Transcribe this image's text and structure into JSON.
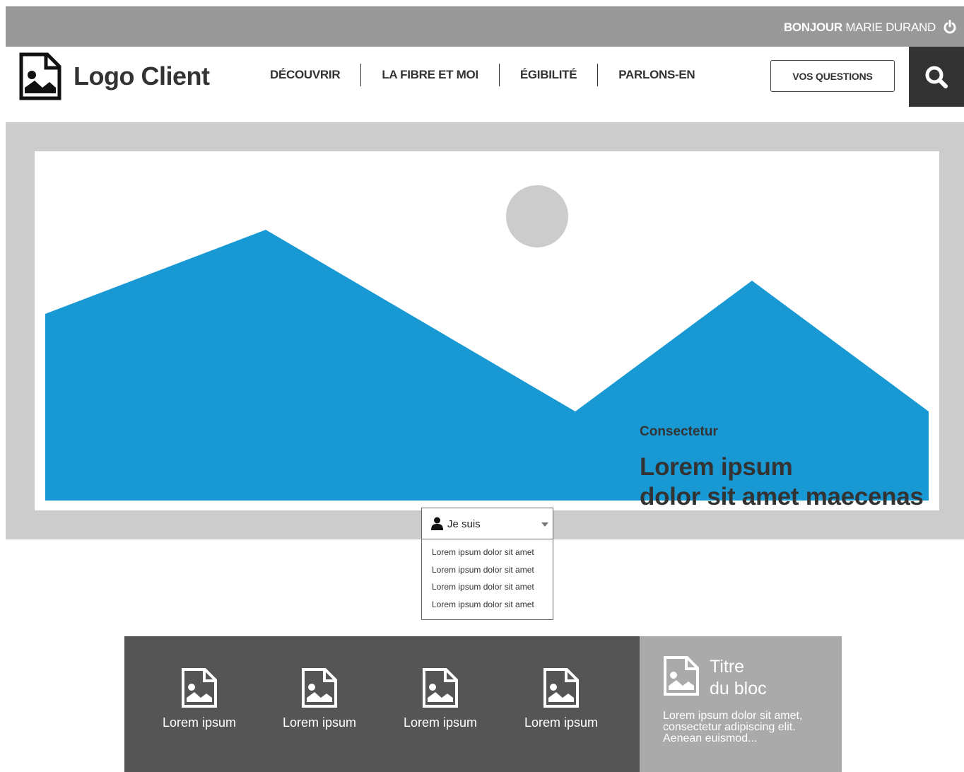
{
  "topbar": {
    "greeting_bold": "BONJOUR",
    "greeting_name": "MARIE DURAND",
    "power_icon": "power-icon"
  },
  "header": {
    "logo_text": "Logo Client",
    "logo_icon": "image-file-icon",
    "nav": [
      "DÉCOUVRIR",
      "LA FIBRE ET MOI",
      "ÉGIBILITÉ",
      "PARLONS-EN"
    ],
    "cta_label": "VOS QUESTIONS",
    "search_icon": "search-icon"
  },
  "hero": {
    "kicker": "Consectetur",
    "title_line1": "Lorem ipsum",
    "title_line2": "dolor sit amet maecenas",
    "mountain_color": "#1899d4",
    "sun_color": "#cccccc"
  },
  "dropdown": {
    "label": "Je suis",
    "options": [
      "Lorem ipsum dolor sit amet",
      "Lorem ipsum dolor sit amet",
      "Lorem ipsum dolor sit amet",
      "Lorem ipsum dolor sit amet"
    ]
  },
  "tiles": [
    {
      "label": "Lorem ipsum",
      "icon": "image-file-icon"
    },
    {
      "label": "Lorem ipsum",
      "icon": "image-file-icon"
    },
    {
      "label": "Lorem ipsum",
      "icon": "image-file-icon"
    },
    {
      "label": "Lorem ipsum",
      "icon": "image-file-icon"
    }
  ],
  "side_block": {
    "title_line1": "Titre",
    "title_line2": "du bloc",
    "text": "Lorem ipsum dolor sit amet, consectetur adipiscing elit. Aenean euismod..."
  },
  "colors": {
    "topbar": "#999999",
    "hero_bg": "#cccccc",
    "tiles_bg": "#555555",
    "side_bg": "#aaaaaa",
    "search_bg": "#333333"
  }
}
